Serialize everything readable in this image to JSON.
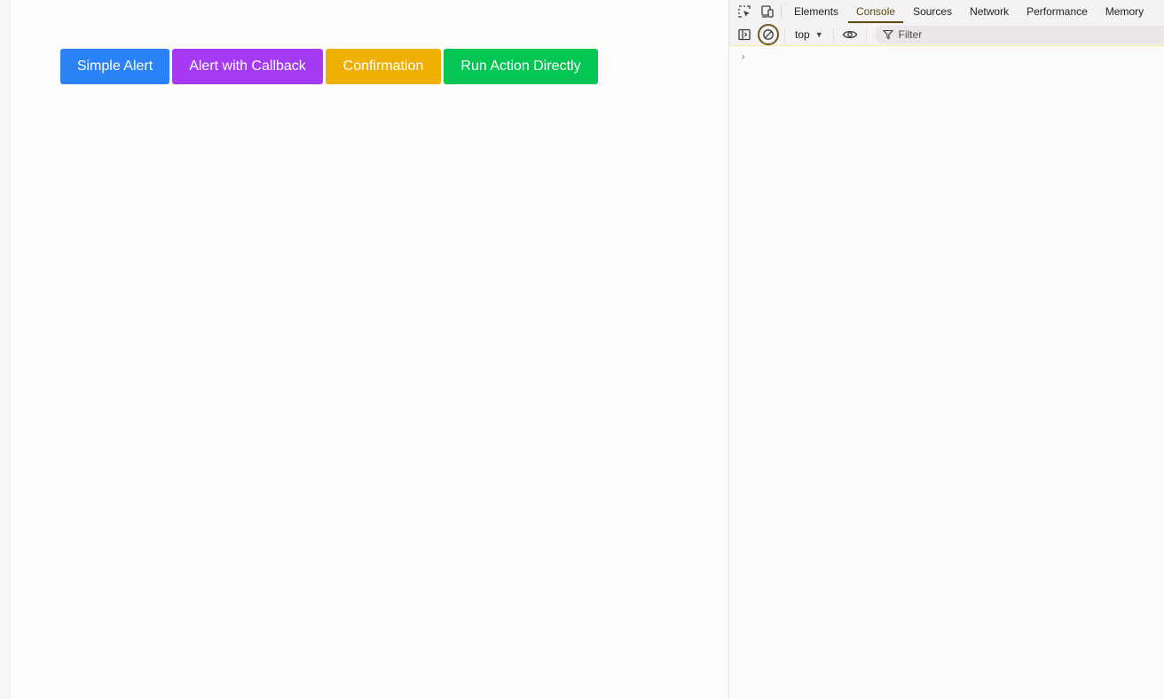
{
  "page": {
    "buttons": [
      {
        "label": "Simple Alert",
        "color": "#2b82f6"
      },
      {
        "label": "Alert with Callback",
        "color": "#a53af4"
      },
      {
        "label": "Confirmation",
        "color": "#efaf05"
      },
      {
        "label": "Run Action Directly",
        "color": "#05c654"
      }
    ]
  },
  "devtools": {
    "tabs": [
      "Elements",
      "Console",
      "Sources",
      "Network",
      "Performance",
      "Memory"
    ],
    "active_tab": "Console",
    "toolbar": {
      "context": "top",
      "filter_placeholder": "Filter"
    },
    "console": {
      "prompt": "›"
    },
    "accent_color": "#5b4a06"
  }
}
